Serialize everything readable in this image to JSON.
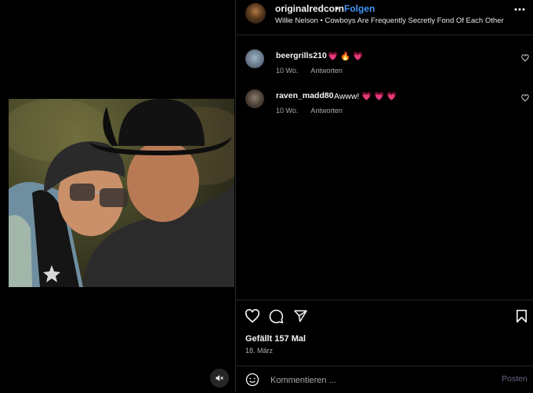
{
  "header": {
    "username": "originalredcorn",
    "separator": "•",
    "follow_label": "Folgen",
    "audio": "Willie Nelson • Cowboys Are Frequently Secretly Fond Of Each Other",
    "more_icon": "more-icon"
  },
  "comments": [
    {
      "username": "beergrills210",
      "text": "💗 🔥 💗",
      "age": "10 Wo.",
      "reply_label": "Antworten"
    },
    {
      "username": "raven_madd80",
      "text": "Awww! 💗 💗 💗",
      "age": "10 Wo.",
      "reply_label": "Antworten"
    }
  ],
  "actions": {
    "likes": "Gefällt 157 Mal",
    "date": "18. März"
  },
  "composer": {
    "placeholder": "Kommentieren ...",
    "post_label": "Posten"
  },
  "colors": {
    "accent": "#4197f5",
    "background": "#000000",
    "divider": "#262626"
  }
}
